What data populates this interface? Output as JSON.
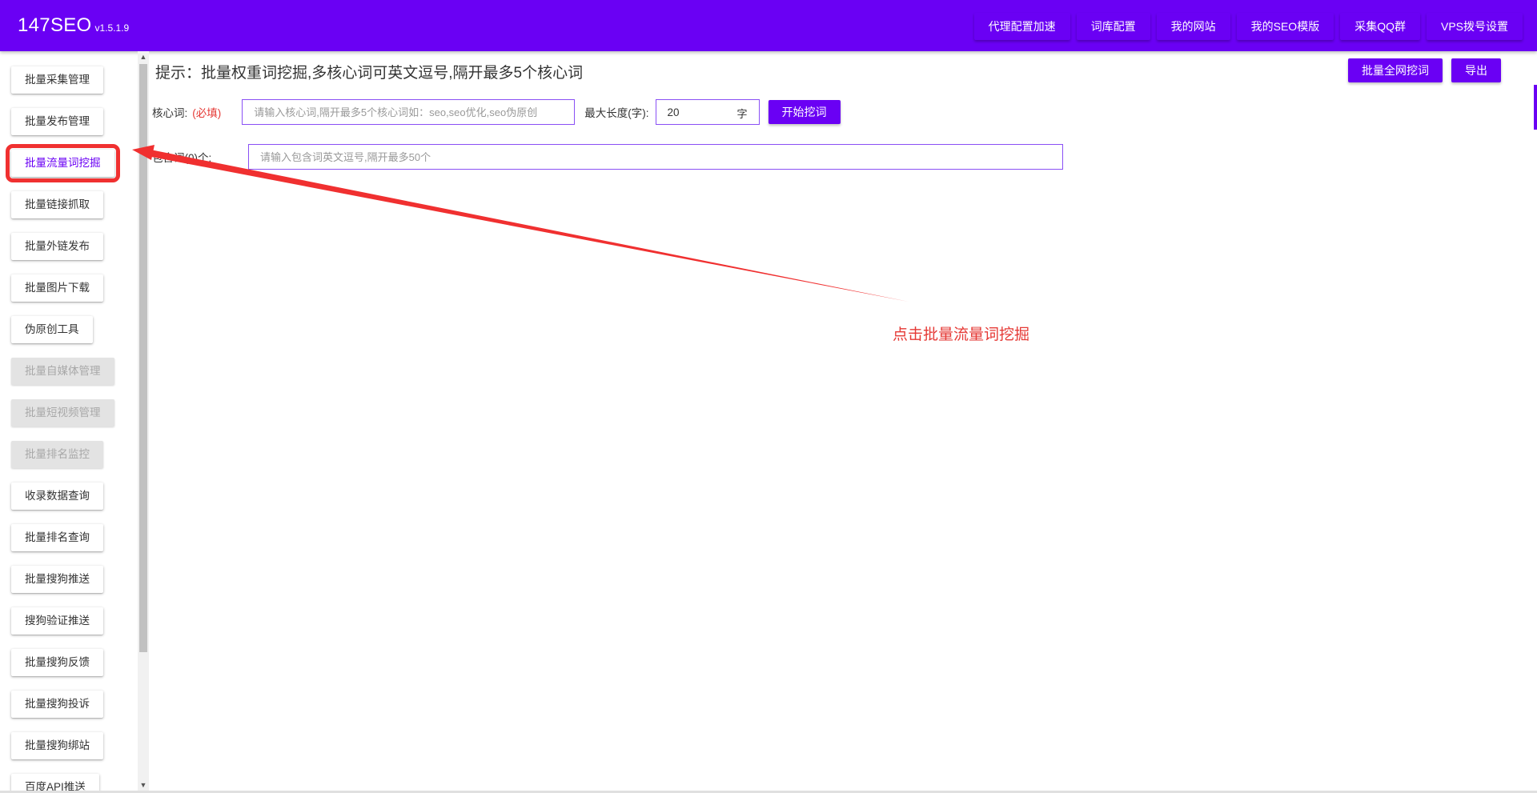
{
  "app": {
    "name": "147SEO",
    "version": "v1.5.1.9"
  },
  "nav": [
    {
      "label": "代理配置加速"
    },
    {
      "label": "词库配置"
    },
    {
      "label": "我的网站"
    },
    {
      "label": "我的SEO模版"
    },
    {
      "label": "采集QQ群"
    },
    {
      "label": "VPS拨号设置"
    }
  ],
  "sidebar": [
    {
      "label": "批量采集管理",
      "state": "normal"
    },
    {
      "label": "批量发布管理",
      "state": "normal"
    },
    {
      "label": "批量流量词挖掘",
      "state": "active"
    },
    {
      "label": "批量链接抓取",
      "state": "normal"
    },
    {
      "label": "批量外链发布",
      "state": "normal"
    },
    {
      "label": "批量图片下载",
      "state": "normal"
    },
    {
      "label": "伪原创工具",
      "state": "normal"
    },
    {
      "label": "批量自媒体管理",
      "state": "disabled"
    },
    {
      "label": "批量短视频管理",
      "state": "disabled"
    },
    {
      "label": "批量排名监控",
      "state": "disabled"
    },
    {
      "label": "收录数据查询",
      "state": "normal"
    },
    {
      "label": "批量排名查询",
      "state": "normal"
    },
    {
      "label": "批量搜狗推送",
      "state": "normal"
    },
    {
      "label": "搜狗验证推送",
      "state": "normal"
    },
    {
      "label": "批量搜狗反馈",
      "state": "normal"
    },
    {
      "label": "批量搜狗投诉",
      "state": "normal"
    },
    {
      "label": "批量搜狗绑站",
      "state": "normal"
    },
    {
      "label": "百度API推送",
      "state": "normal"
    }
  ],
  "main": {
    "hint": "提示：批量权重词挖掘,多核心词可英文逗号,隔开最多5个核心词",
    "actions": {
      "batch_label": "批量全网挖词",
      "export_label": "导出"
    },
    "core": {
      "label": "核心词:",
      "required": "(必填)",
      "placeholder": "请输入核心词,隔开最多5个核心词如：seo,seo优化,seo伪原创"
    },
    "max_len": {
      "label": "最大长度(字):",
      "value": "20",
      "unit": "字"
    },
    "start_label": "开始挖词",
    "include": {
      "label": "包含词(0)个:",
      "placeholder": "请输入包含词英文逗号,隔开最多50个"
    }
  },
  "annotation": {
    "text": "点击批量流量词挖掘",
    "color": "#e53935"
  },
  "colors": {
    "accent": "#6a00f4",
    "highlight": "#f03030",
    "disabled": "#e3e3e3"
  }
}
